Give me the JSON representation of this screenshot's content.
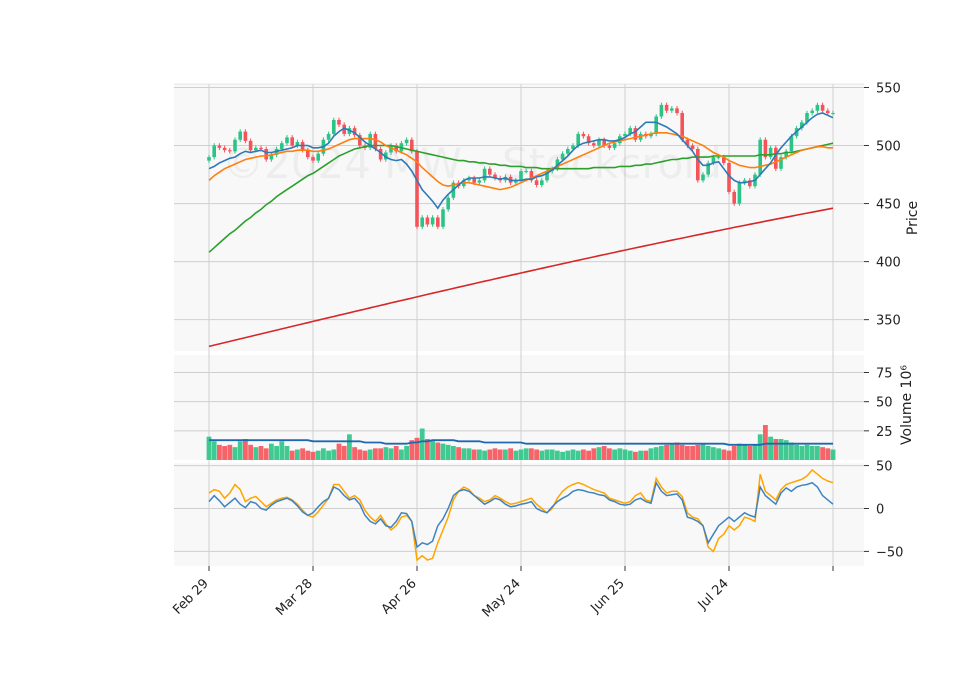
{
  "chart_data": {
    "type": "candlestick",
    "watermark": "©2024 MW · Stockcroid",
    "colors": {
      "up": "#2bc486",
      "down": "#f5535a",
      "ma_short": "#2c7ab8",
      "ma_mid": "#ff7f0e",
      "ma_long": "#2ca02c",
      "ma_200": "#d62728",
      "volume_ma": "#1f67b0",
      "osc_fast": "#3f84c0",
      "osc_slow": "#ffa500",
      "panel_bg": "#f8f8f8",
      "grid": "#cfcfcf"
    },
    "x_ticks": [
      {
        "label": "Feb 29",
        "index": 0
      },
      {
        "label": "Mar 28",
        "index": 20
      },
      {
        "label": "Apr 26",
        "index": 40
      },
      {
        "label": "May 24",
        "index": 60
      },
      {
        "label": "Jun 25",
        "index": 80
      },
      {
        "label": "Jul 24",
        "index": 100
      },
      {
        "label": "",
        "index": 120
      }
    ],
    "price_panel": {
      "ylabel": "Price",
      "ylim": [
        323,
        553
      ],
      "yticks": [
        350,
        400,
        450,
        500,
        550
      ],
      "closes": [
        490,
        500,
        498,
        496,
        495,
        505,
        512,
        504,
        496,
        498,
        497,
        488,
        492,
        497,
        502,
        507,
        500,
        503,
        496,
        490,
        487,
        493,
        505,
        510,
        522,
        518,
        510,
        515,
        509,
        500,
        498,
        510,
        497,
        488,
        494,
        500,
        495,
        502,
        505,
        495,
        430,
        438,
        432,
        438,
        430,
        445,
        455,
        468,
        465,
        470,
        472,
        468,
        470,
        480,
        475,
        472,
        470,
        473,
        468,
        470,
        478,
        478,
        470,
        466,
        470,
        478,
        480,
        488,
        493,
        497,
        500,
        510,
        508,
        502,
        500,
        505,
        500,
        498,
        502,
        508,
        510,
        515,
        505,
        510,
        508,
        510,
        525,
        535,
        530,
        532,
        528,
        505,
        500,
        497,
        470,
        475,
        485,
        490,
        490,
        485,
        460,
        450,
        468,
        470,
        465,
        475,
        505,
        490,
        498,
        480,
        490,
        495,
        508,
        515,
        520,
        528,
        530,
        535,
        530,
        528,
        528
      ],
      "ma_short": [
        480,
        482,
        485,
        487,
        489,
        490,
        493,
        495,
        494,
        495,
        496,
        494,
        494,
        495,
        496,
        497,
        498,
        500,
        500,
        500,
        498,
        498,
        499,
        502,
        508,
        512,
        515,
        513,
        511,
        507,
        503,
        500,
        497,
        494,
        490,
        488,
        487,
        488,
        484,
        478,
        470,
        462,
        457,
        452,
        446,
        453,
        458,
        462,
        466,
        470,
        472,
        472,
        472,
        473,
        473,
        472,
        471,
        472,
        470,
        470,
        470,
        471,
        471,
        473,
        474,
        476,
        479,
        483,
        487,
        491,
        496,
        500,
        502,
        503,
        504,
        505,
        505,
        504,
        504,
        505,
        507,
        510,
        512,
        516,
        520,
        520,
        520,
        518,
        516,
        513,
        510,
        505,
        500,
        495,
        488,
        483,
        483,
        485,
        486,
        480,
        474,
        470,
        468,
        468,
        469,
        470,
        475,
        480,
        485,
        492,
        498,
        503,
        508,
        512,
        516,
        520,
        524,
        527,
        528,
        526,
        524
      ],
      "ma_mid": [
        470,
        474,
        477,
        480,
        482,
        484,
        486,
        488,
        489,
        490,
        491,
        491,
        492,
        493,
        494,
        495,
        495,
        496,
        496,
        496,
        495,
        495,
        496,
        497,
        499,
        501,
        503,
        505,
        506,
        506,
        506,
        506,
        505,
        503,
        500,
        498,
        496,
        494,
        492,
        489,
        486,
        481,
        477,
        473,
        469,
        466,
        465,
        466,
        467,
        468,
        468,
        467,
        466,
        465,
        464,
        463,
        462,
        463,
        464,
        466,
        468,
        470,
        472,
        474,
        476,
        478,
        480,
        482,
        484,
        486,
        488,
        490,
        492,
        494,
        496,
        498,
        500,
        502,
        503,
        504,
        505,
        506,
        507,
        508,
        509,
        510,
        511,
        511,
        511,
        510,
        509,
        508,
        506,
        504,
        502,
        500,
        497,
        494,
        492,
        490,
        487,
        485,
        483,
        482,
        481,
        481,
        482,
        483,
        484,
        486,
        488,
        490,
        492,
        494,
        496,
        497,
        498,
        499,
        499,
        498,
        498
      ],
      "ma_long": [
        408,
        412,
        416,
        420,
        424,
        427,
        431,
        435,
        438,
        442,
        445,
        449,
        452,
        456,
        459,
        462,
        465,
        468,
        471,
        474,
        476,
        479,
        482,
        485,
        488,
        491,
        493,
        495,
        497,
        498,
        499,
        500,
        500,
        500,
        500,
        500,
        499,
        498,
        497,
        496,
        495,
        494,
        493,
        492,
        491,
        490,
        489,
        488,
        487,
        487,
        486,
        486,
        485,
        485,
        484,
        484,
        483,
        483,
        482,
        482,
        482,
        481,
        481,
        481,
        480,
        480,
        480,
        480,
        480,
        480,
        480,
        480,
        480,
        480,
        481,
        481,
        481,
        481,
        481,
        482,
        482,
        482,
        483,
        483,
        484,
        484,
        485,
        486,
        487,
        488,
        488,
        489,
        489,
        490,
        490,
        490,
        490,
        491,
        491,
        491,
        491,
        491,
        491,
        491,
        491,
        491,
        492,
        492,
        492,
        493,
        493,
        494,
        494,
        495,
        496,
        497,
        498,
        499,
        500,
        501,
        502
      ],
      "ma_200_start": 327,
      "ma_200_end": 446
    },
    "volume_panel": {
      "ylabel": "Volume  10⁶",
      "ylim": [
        0,
        90
      ],
      "yticks": [
        25,
        50,
        75
      ],
      "volumes": [
        20,
        16,
        13,
        12,
        13,
        11,
        16,
        18,
        13,
        11,
        12,
        10,
        14,
        12,
        16,
        12,
        8,
        9,
        10,
        8,
        7,
        8,
        10,
        8,
        9,
        14,
        12,
        22,
        11,
        9,
        8,
        9,
        10,
        10,
        11,
        10,
        12,
        9,
        12,
        17,
        19,
        27,
        18,
        17,
        15,
        14,
        13,
        12,
        11,
        10,
        10,
        9,
        9,
        8,
        9,
        10,
        9,
        9,
        10,
        8,
        9,
        10,
        10,
        9,
        8,
        9,
        9,
        8,
        7,
        8,
        9,
        8,
        9,
        8,
        10,
        11,
        12,
        10,
        9,
        10,
        9,
        8,
        7,
        8,
        8,
        10,
        11,
        12,
        13,
        14,
        15,
        13,
        12,
        12,
        13,
        14,
        12,
        11,
        10,
        9,
        8,
        12,
        14,
        13,
        12,
        13,
        22,
        30,
        20,
        18,
        18,
        17,
        15,
        13,
        12,
        13,
        12,
        12,
        11,
        10,
        9
      ],
      "volume_ma": [
        17,
        17,
        17,
        17,
        17,
        17,
        17,
        17,
        17,
        17,
        17,
        17,
        17,
        17,
        17,
        17,
        17,
        17,
        17,
        17,
        16,
        16,
        16,
        16,
        16,
        16,
        16,
        16,
        16,
        16,
        15,
        15,
        15,
        15,
        14,
        14,
        14,
        14,
        14,
        15,
        15,
        16,
        16,
        17,
        17,
        17,
        17,
        17,
        16,
        16,
        16,
        16,
        16,
        15,
        15,
        15,
        15,
        15,
        15,
        15,
        15,
        14,
        14,
        14,
        14,
        14,
        14,
        14,
        14,
        14,
        14,
        14,
        14,
        14,
        14,
        14,
        14,
        14,
        14,
        14,
        14,
        14,
        14,
        14,
        14,
        14,
        14,
        14,
        14,
        14,
        14,
        14,
        14,
        14,
        14,
        14,
        14,
        14,
        14,
        14,
        13,
        13,
        13,
        13,
        13,
        13,
        13,
        14,
        14,
        14,
        14,
        14,
        14,
        14,
        14,
        14,
        14,
        14,
        14,
        14,
        14
      ]
    },
    "osc_panel": {
      "ylim": [
        -67,
        53
      ],
      "yticks": [
        -50,
        0,
        50
      ],
      "fast": [
        8,
        15,
        9,
        2,
        7,
        12,
        5,
        1,
        8,
        6,
        0,
        -2,
        4,
        8,
        10,
        12,
        9,
        3,
        -4,
        -8,
        -5,
        2,
        8,
        12,
        25,
        22,
        15,
        10,
        12,
        5,
        -8,
        -15,
        -18,
        -12,
        -20,
        -22,
        -15,
        -5,
        -6,
        -15,
        -45,
        -40,
        -42,
        -38,
        -20,
        -12,
        0,
        15,
        20,
        22,
        20,
        15,
        10,
        5,
        8,
        12,
        10,
        5,
        2,
        3,
        5,
        6,
        8,
        0,
        -3,
        -5,
        2,
        8,
        12,
        15,
        20,
        22,
        21,
        19,
        18,
        16,
        15,
        10,
        8,
        5,
        4,
        5,
        10,
        12,
        8,
        6,
        30,
        20,
        15,
        16,
        17,
        10,
        -10,
        -12,
        -15,
        -20,
        -40,
        -30,
        -20,
        -15,
        -10,
        -15,
        -10,
        -5,
        -8,
        -10,
        25,
        15,
        10,
        5,
        18,
        24,
        20,
        25,
        27,
        28,
        30,
        25,
        15,
        10,
        5
      ],
      "slow": [
        18,
        22,
        20,
        12,
        18,
        28,
        22,
        8,
        12,
        14,
        8,
        2,
        6,
        10,
        12,
        13,
        10,
        5,
        -2,
        -8,
        -10,
        -4,
        4,
        12,
        28,
        28,
        20,
        12,
        15,
        10,
        -2,
        -10,
        -15,
        -8,
        -18,
        -25,
        -20,
        -10,
        -8,
        -15,
        -60,
        -55,
        -60,
        -58,
        -40,
        -25,
        -10,
        10,
        20,
        25,
        22,
        15,
        12,
        8,
        10,
        15,
        12,
        8,
        5,
        6,
        8,
        10,
        12,
        5,
        0,
        -5,
        0,
        12,
        20,
        25,
        28,
        30,
        28,
        25,
        22,
        20,
        18,
        12,
        10,
        8,
        6,
        8,
        15,
        18,
        10,
        8,
        35,
        25,
        18,
        20,
        20,
        14,
        -5,
        -10,
        -12,
        -20,
        -45,
        -50,
        -35,
        -30,
        -20,
        -25,
        -20,
        -10,
        -12,
        -15,
        40,
        20,
        15,
        10,
        22,
        28,
        30,
        32,
        34,
        38,
        45,
        40,
        35,
        32,
        30
      ]
    }
  }
}
